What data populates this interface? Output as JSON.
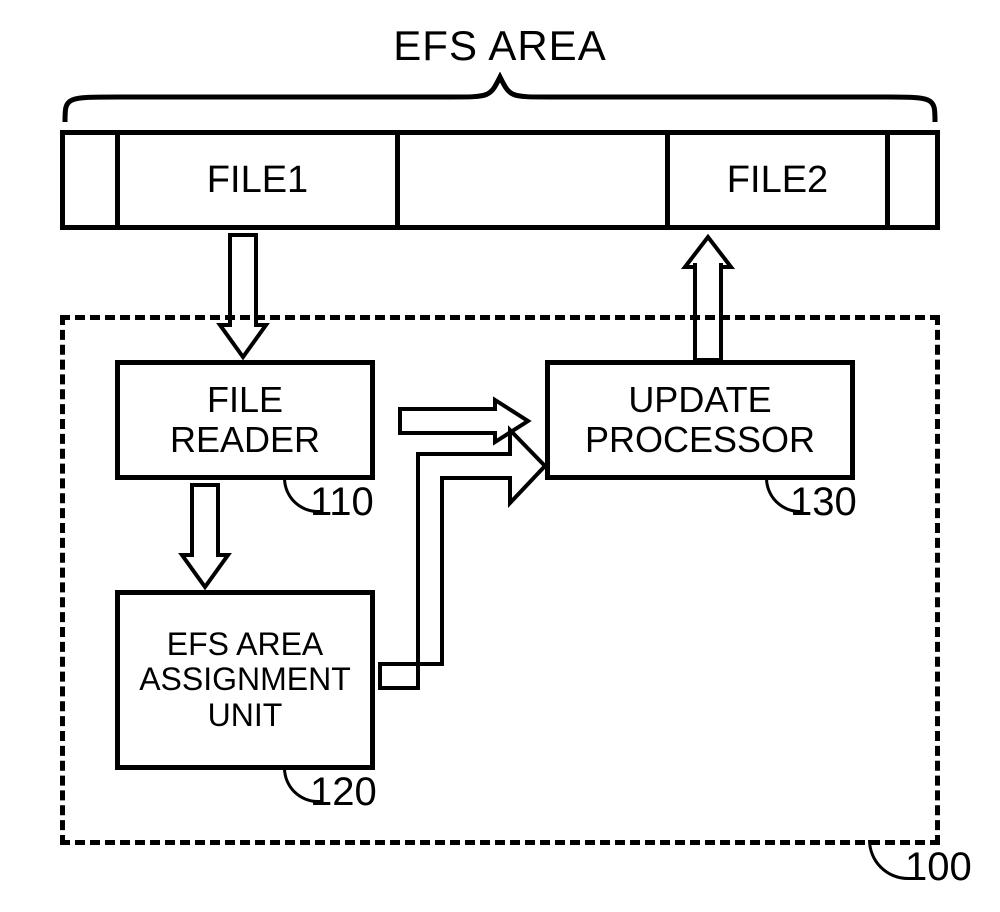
{
  "title": "EFS AREA",
  "efs_bar": {
    "file1": "FILE1",
    "file2": "FILE2"
  },
  "blocks": {
    "file_reader": {
      "line1": "FILE",
      "line2": "READER",
      "ref": "110"
    },
    "update_processor": {
      "line1": "UPDATE",
      "line2": "PROCESSOR",
      "ref": "130"
    },
    "efs_assignment": {
      "line1": "EFS AREA",
      "line2": "ASSIGNMENT",
      "line3": "UNIT",
      "ref": "120"
    }
  },
  "container_ref": "100"
}
